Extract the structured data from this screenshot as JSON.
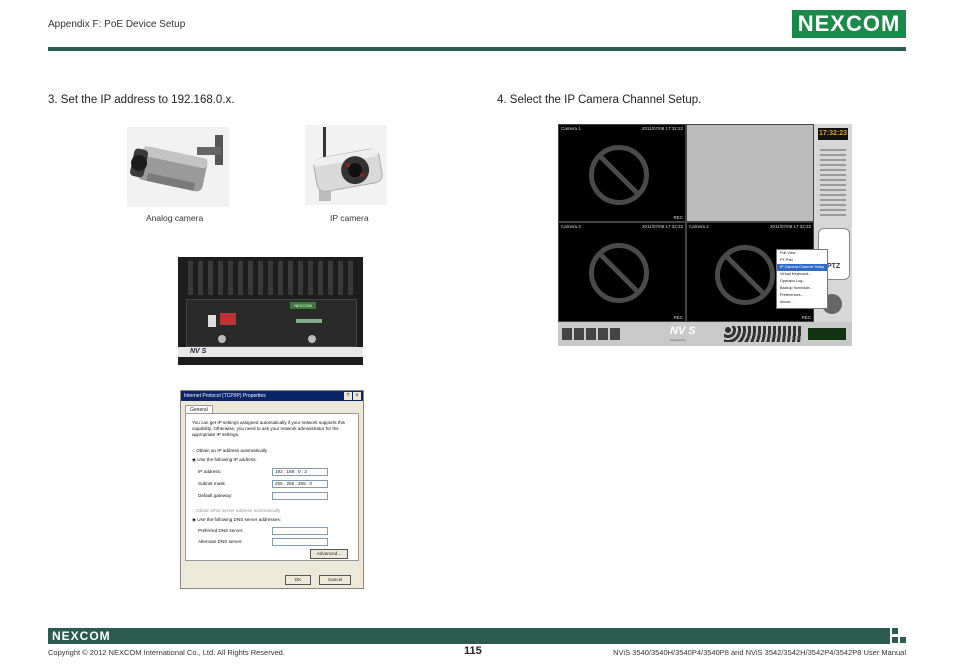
{
  "header": {
    "section": "Appendix F: PoE Device Setup",
    "logo": "NEXCOM"
  },
  "steps": {
    "step3": "3.  Set the IP address to 192.168.0.x.",
    "step4": "4.  Select the IP Camera Channel Setup."
  },
  "captions": {
    "analog": "Analog camera",
    "ip": "IP camera"
  },
  "device": {
    "label": "NV S",
    "badge": "NEXCOM"
  },
  "dialog": {
    "title": "Internet Protocol (TCP/IP) Properties",
    "tab": "General",
    "intro": "You can get IP settings assigned automatically if your network supports this capability. Otherwise, you need to ask your network administrator for the appropriate IP settings.",
    "opt_auto": "Obtain an IP address automatically",
    "opt_manual": "Use the following IP address:",
    "ip_label": "IP address:",
    "ip_value": "192 . 168 . 0 . 2",
    "mask_label": "Subnet mask:",
    "mask_value": "255 . 255 . 255 . 0",
    "gateway_label": "Default gateway:",
    "dns_auto": "Obtain DNS server address automatically",
    "dns_manual": "Use the following DNS server addresses:",
    "dns_pref": "Preferred DNS server:",
    "dns_alt": "Alternate DNS server:",
    "advanced": "Advanced...",
    "ok": "OK",
    "cancel": "Cancel"
  },
  "nvs": {
    "cam1": "Camera 1",
    "cam1_time": "2011/07/08 17:32:22",
    "cam3": "Camera 3",
    "cam3_time": "2011/07/08 17:32:22",
    "cam2": "Camera 2",
    "cam2_time": "2011/07/08 17:32:22",
    "rec": "REC",
    "clock": "17:32:23",
    "ptz": "PTZ",
    "brand": "NV S",
    "powered": "Powered by",
    "menu": [
      "Full View",
      "PT-Pad",
      "IP Camera Channel Setup",
      "Virtual Keyboard...",
      "Operator Log...",
      "Backup Schedule...",
      "Preferences...",
      "About..."
    ]
  },
  "footer": {
    "logo": "NEXCOM",
    "copyright": "Copyright © 2012 NEXCOM International Co., Ltd. All Rights Reserved.",
    "page": "115",
    "manual": "NViS 3540/3540H/3540P4/3540P8 and NViS 3542/3542H/3542P4/3542P8 User Manual"
  }
}
